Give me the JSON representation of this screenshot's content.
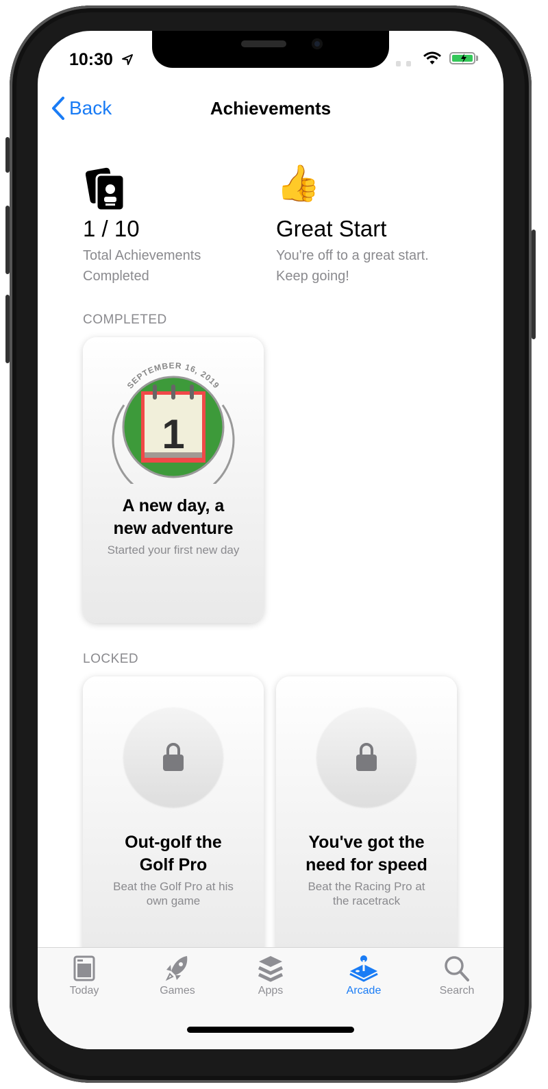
{
  "status_bar": {
    "time": "10:30",
    "icons": [
      "location-arrow-icon",
      "wifi-icon",
      "battery-charging-icon"
    ],
    "battery_color": "#34c759"
  },
  "nav": {
    "back_label": "Back",
    "title": "Achievements",
    "accent": "#1a7cf5"
  },
  "summary": {
    "total": {
      "icon": "achievement-cards-icon",
      "value": "1 / 10",
      "line1": "Total Achievements",
      "line2": "Completed"
    },
    "rank": {
      "icon": "thumbs-up-emoji",
      "title": "Great Start",
      "line1": "You're off to a great start.",
      "line2": "Keep going!"
    }
  },
  "completed": {
    "header": "COMPLETED",
    "items": [
      {
        "date": "SEPTEMBER 16, 2019",
        "badge_number": "1",
        "title_line1": "A new day, a",
        "title_line2": "new adventure",
        "description": "Started your first new day"
      }
    ]
  },
  "locked": {
    "header": "LOCKED",
    "items": [
      {
        "title_line1": "Out-golf the",
        "title_line2": "Golf Pro",
        "desc_line1": "Beat the Golf Pro at his",
        "desc_line2": "own game"
      },
      {
        "title_line1": "You've got the",
        "title_line2": "need for speed",
        "desc_line1": "Beat the Racing Pro at",
        "desc_line2": "the racetrack"
      }
    ]
  },
  "tabbar": {
    "active": "Arcade",
    "active_color": "#1a7cf5",
    "items": [
      {
        "label": "Today",
        "icon": "today-icon"
      },
      {
        "label": "Games",
        "icon": "rocket-icon"
      },
      {
        "label": "Apps",
        "icon": "layers-icon"
      },
      {
        "label": "Arcade",
        "icon": "joystick-icon"
      },
      {
        "label": "Search",
        "icon": "search-icon"
      }
    ]
  }
}
